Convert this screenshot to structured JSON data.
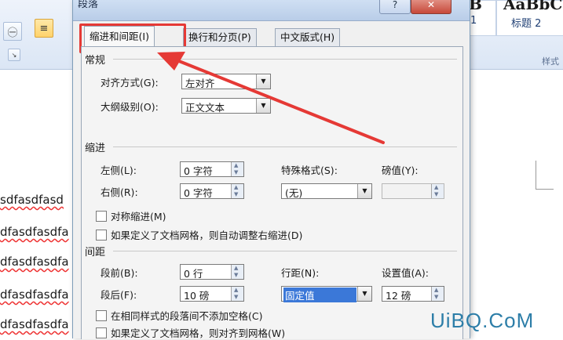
{
  "ribbon": {
    "style1_sample": "B",
    "style2_sample": "AaBbC",
    "style1_label": "1",
    "style2_label": "标题 2",
    "group_label": "样式",
    "align_icon": "align-left-icon",
    "circle_icon": "circle-char-icon"
  },
  "document": {
    "lines": [
      "sdfasdfasd",
      "dfasdfasdfa",
      "dfasdfasdfa",
      "dfasdfasdfa",
      "dfasdfasdfa",
      "dfasdfasdfa"
    ]
  },
  "dialog": {
    "title": "段落",
    "help_label": "?",
    "close_label": "✕",
    "tabs": [
      "缩进和间距(I)",
      "换行和分页(P)",
      "中文版式(H)"
    ],
    "general": {
      "heading": "常规",
      "alignment_label": "对齐方式(G):",
      "alignment_value": "左对齐",
      "outline_label": "大纲级别(O):",
      "outline_value": "正文文本"
    },
    "indent": {
      "heading": "缩进",
      "left_label": "左侧(L):",
      "left_value": "0 字符",
      "right_label": "右侧(R):",
      "right_value": "0 字符",
      "special_label": "特殊格式(S):",
      "special_value": "(无)",
      "by_label": "磅值(Y):",
      "by_value": "",
      "mirror_label": "对称缩进(M)",
      "grid_label": "如果定义了文档网格，则自动调整右缩进(D)"
    },
    "spacing": {
      "heading": "间距",
      "before_label": "段前(B):",
      "before_value": "0 行",
      "after_label": "段后(F):",
      "after_value": "10 磅",
      "line_label": "行距(N):",
      "line_value": "固定值",
      "at_label": "设置值(A):",
      "at_value": "12 磅",
      "no_space_label": "在相同样式的段落间不添加空格(C)",
      "snap_label": "如果定义了文档网格，则对齐到网格(W)"
    }
  },
  "watermark": "UiBQ.CoM",
  "colors": {
    "highlight": "#e53935",
    "watermark": "#2d7ea8",
    "selection": "#3b78d8"
  }
}
